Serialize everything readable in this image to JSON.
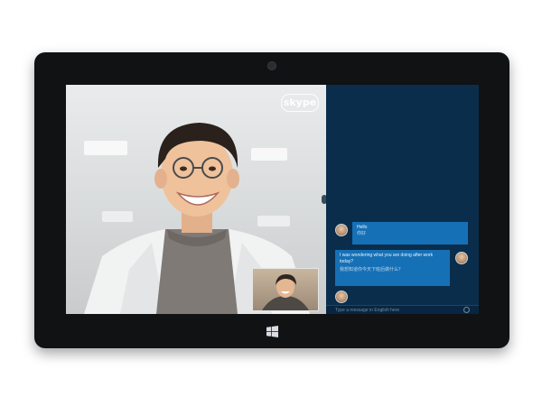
{
  "app": {
    "name": "Skype"
  },
  "video": {
    "logo_text": "skype"
  },
  "chat": {
    "messages": [
      {
        "from": "remote",
        "text": "Hello",
        "translation": "你好"
      },
      {
        "from": "local",
        "text": "I was wondering what you are doing after work today?",
        "translation": "我想知道你今天下班后做什么？"
      }
    ],
    "input_placeholder": "Type a message in English here"
  },
  "colors": {
    "chat_background": "#0a2d4b",
    "bubble": "#1670b6",
    "tablet_bezel": "#111214"
  },
  "icons": {
    "windows_button": "windows-logo",
    "emoji_button": "smiley"
  }
}
